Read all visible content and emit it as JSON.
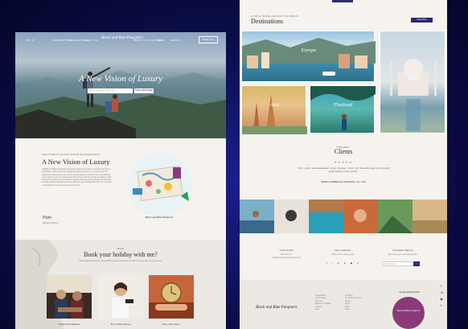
{
  "left_page": {
    "nav": {
      "left_items": [
        "FR · IT"
      ],
      "items": [
        "DESTINATIONS",
        "TRAVEL IDEAS",
        "WHY US",
        "BOOK YOUR HOLIDAY",
        "BLOG",
        "ABOUT"
      ],
      "logo": "Black and Blue Passports",
      "cta": "Book Now"
    },
    "hero": {
      "title": "A New Vision of Luxury",
      "search_placeholder": "Where would you like to go?",
      "search_button": "DISCOVER MORE"
    },
    "welcome": {
      "kicker": "WELCOME TO BLACK AND BLUE PASSPORTS",
      "heading": "A New Vision of Luxury",
      "body": "At Black and Blue Passports we believe that travel is about so much more than a destination. Each journey we design is crafted around you, your story and the experiences that matter most. From remote islands to vibrant cities, we handpick every detail so you can simply enjoy the moment and the people you share it with. Our team combines years of travel expertise with a genuine passion for discovery, creating holidays that feel personal, effortless and unforgettable from the very first conversation to the moment you return home.",
      "sign": "Pam",
      "sign_role": "Managing Director",
      "illustration_label": "Black and Blue Passports"
    },
    "book": {
      "kicker": "BOOK",
      "heading": "Book your holiday with me?",
      "body": "Personalised itineraries, trusted partners and a real person to talk to at every step of your journey.",
      "cards": [
        {
          "caption": "Fully Personalised"
        },
        {
          "caption": "For a Real person"
        },
        {
          "caption": "Save your time !"
        }
      ]
    }
  },
  "right_page": {
    "top_button": "",
    "destinations": {
      "kicker": "CLICK & TRAVEL AROUND THE WORLD",
      "heading": "Destinations",
      "view_more": "View More",
      "tiles": [
        "Europe",
        "India",
        "Asia",
        "Thailand"
      ]
    },
    "clients": {
      "kicker": "OUR HAPPY",
      "heading": "Clients",
      "stars": "★★★★★",
      "quote": "\"Fast · clock · Accommodation · clock · Ecoway · clock · Yes! Book You took us to the most perfect places in the world!\"",
      "author": "MARK & REBECCA JOHNSON, CA, USA"
    },
    "footer": {
      "col1_title": "Get In Touch",
      "col1_lines": [
        "Call: Hello Us",
        "info@blackandbluepassports.com"
      ],
      "col2_title": "Stay Connected",
      "col2_lines": [
        "Follow us on social media"
      ],
      "col3_title": "Newsletter Sign Up",
      "col3_lines": [
        "Sign up for news and special offers"
      ],
      "email_placeholder": "Email Address",
      "logo": "Black and Blue Passports",
      "links_a": [
        "Destinations",
        "Travel Ideas",
        "Why Us",
        "Book Your Holiday",
        "Contact",
        "Blog"
      ],
      "links_b": [
        "Our Blog",
        "Terms & Conditions",
        "Privacy",
        "FAQs",
        "Help",
        "About"
      ],
      "partnership_title": "In Partnership With",
      "partner_badge": "Black and Blue Passports"
    },
    "side_icons": [
      "facebook-icon",
      "instagram-icon",
      "youtube-icon",
      "twitter-icon"
    ]
  },
  "colors": {
    "navy": "#2a2c6e",
    "cream": "#f6f3ef",
    "purple": "#8a3a7a",
    "background": "#0b0d4a"
  }
}
